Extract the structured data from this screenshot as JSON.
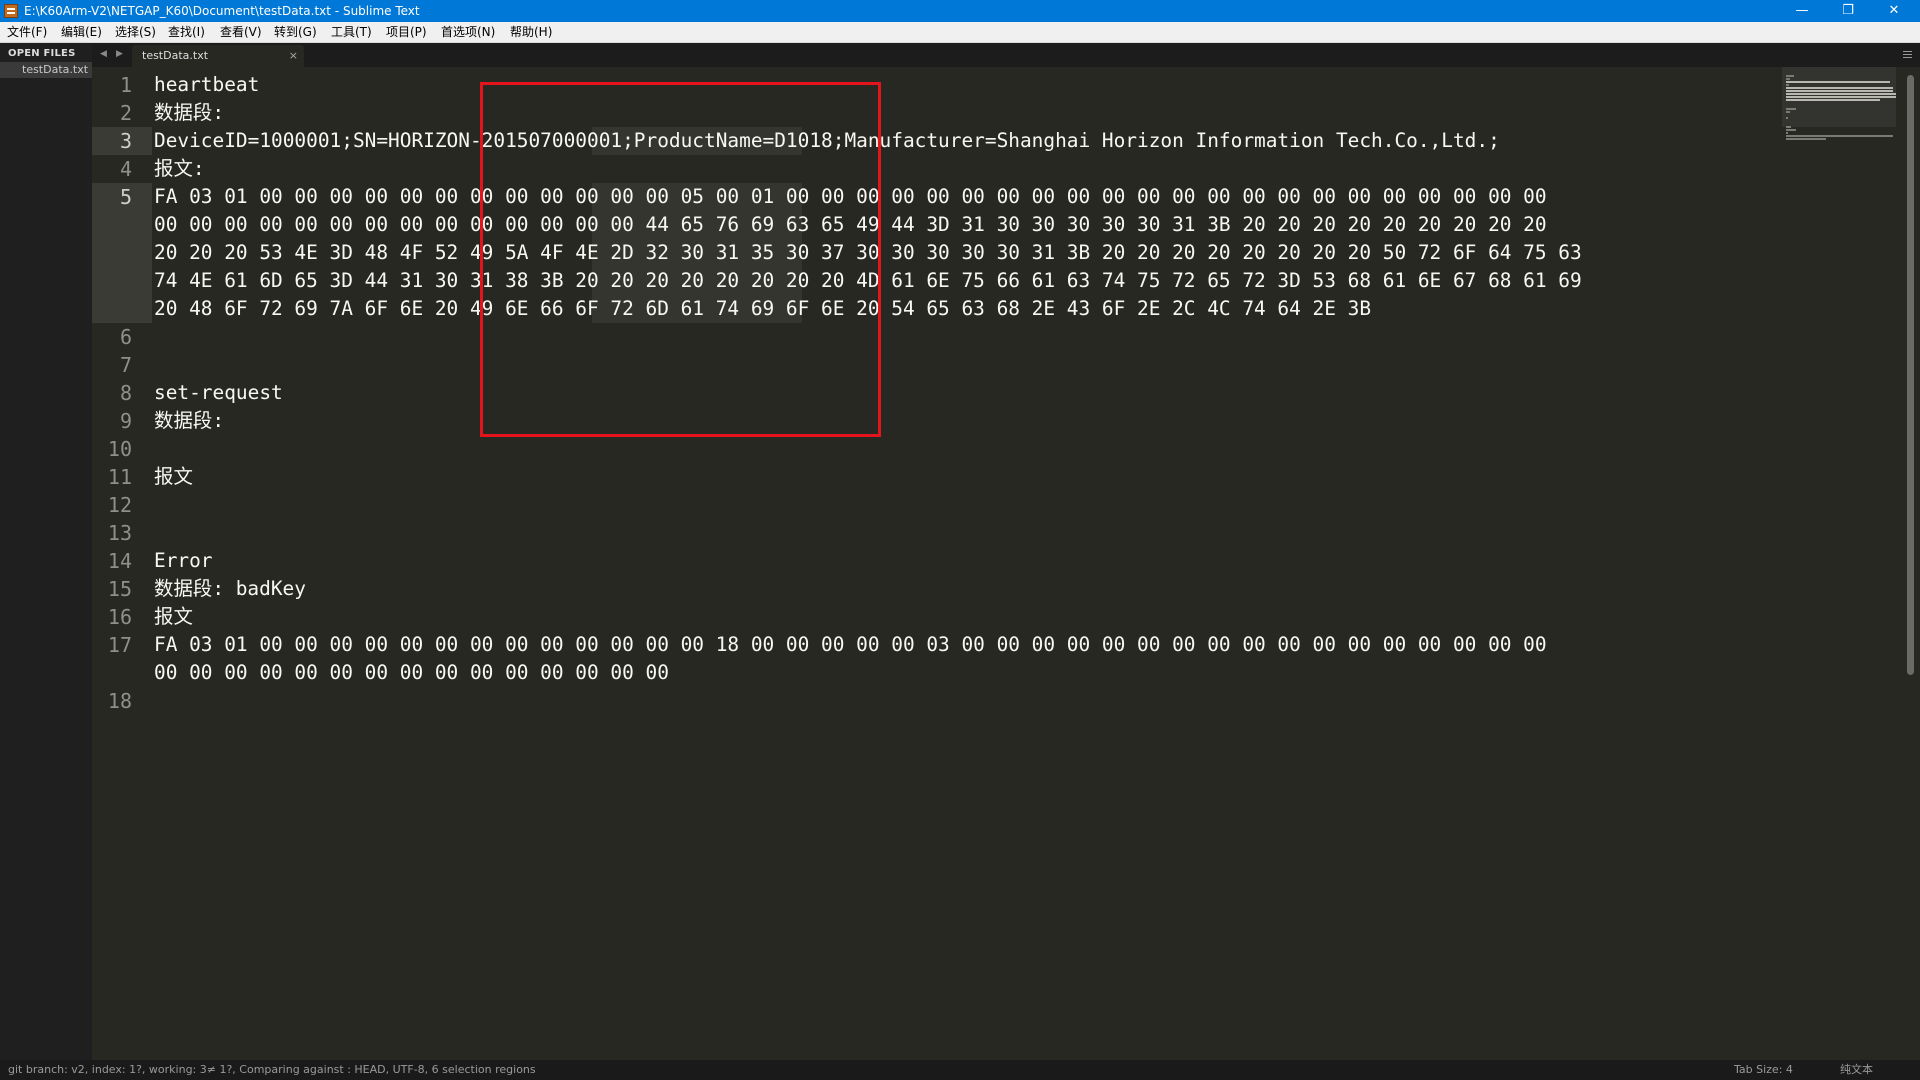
{
  "window": {
    "title": "E:\\K60Arm-V2\\NETGAP_K60\\Document\\testData.txt - Sublime Text",
    "minimize_glyph": "—",
    "restore_glyph": "❐",
    "close_glyph": "✕"
  },
  "menu": [
    "文件(F)",
    "编辑(E)",
    "选择(S)",
    "查找(I)",
    "查看(V)",
    "转到(G)",
    "工具(T)",
    "项目(P)",
    "首选项(N)",
    "帮助(H)"
  ],
  "sidebar": {
    "header": "OPEN FILES",
    "files": [
      "testData.txt"
    ]
  },
  "tabs": [
    {
      "label": "testData.txt",
      "close": "×"
    }
  ],
  "nav": {
    "back": "◀",
    "forward": "▶"
  },
  "editor": {
    "active_lines": [
      "3",
      "5"
    ],
    "lines": [
      {
        "num": "1",
        "rows": [
          "heartbeat"
        ]
      },
      {
        "num": "2",
        "rows": [
          "数据段:"
        ]
      },
      {
        "num": "3",
        "rows": [
          "DeviceID=1000001;SN=HORIZON-201507000001;ProductName=D1018;Manufacturer=Shanghai Horizon Information Tech.Co.,Ltd.;"
        ]
      },
      {
        "num": "4",
        "rows": [
          "报文:"
        ]
      },
      {
        "num": "5",
        "rows": [
          "FA 03 01 00 00 00 00 00 00 00 00 00 00 00 00 05 00 01 00 00 00 00 00 00 00 00 00 00 00 00 00 00 00 00 00 00 00 00 00 00",
          "00 00 00 00 00 00 00 00 00 00 00 00 00 00 44 65 76 69 63 65 49 44 3D 31 30 30 30 30 30 31 3B 20 20 20 20 20 20 20 20 20",
          "20 20 20 53 4E 3D 48 4F 52 49 5A 4F 4E 2D 32 30 31 35 30 37 30 30 30 30 30 31 3B 20 20 20 20 20 20 20 20 50 72 6F 64 75 63",
          "74 4E 61 6D 65 3D 44 31 30 31 38 3B 20 20 20 20 20 20 20 20 4D 61 6E 75 66 61 63 74 75 72 65 72 3D 53 68 61 6E 67 68 61 69",
          "20 48 6F 72 69 7A 6F 6E 20 49 6E 66 6F 72 6D 61 74 69 6F 6E 20 54 65 63 68 2E 43 6F 2E 2C 4C 74 64 2E 3B"
        ]
      },
      {
        "num": "6",
        "rows": [
          ""
        ]
      },
      {
        "num": "7",
        "rows": [
          ""
        ]
      },
      {
        "num": "8",
        "rows": [
          "set-request"
        ]
      },
      {
        "num": "9",
        "rows": [
          "数据段:"
        ]
      },
      {
        "num": "10",
        "rows": [
          ""
        ]
      },
      {
        "num": "11",
        "rows": [
          "报文"
        ]
      },
      {
        "num": "12",
        "rows": [
          ""
        ]
      },
      {
        "num": "13",
        "rows": [
          ""
        ]
      },
      {
        "num": "14",
        "rows": [
          "Error"
        ]
      },
      {
        "num": "15",
        "rows": [
          "数据段: badKey"
        ]
      },
      {
        "num": "16",
        "rows": [
          "报文"
        ]
      },
      {
        "num": "17",
        "rows": [
          "FA 03 01 00 00 00 00 00 00 00 00 00 00 00 00 00 18 00 00 00 00 00 03 00 00 00 00 00 00 00 00 00 00 00 00 00 00 00 00 00",
          "00 00 00 00 00 00 00 00 00 00 00 00 00 00 00"
        ]
      },
      {
        "num": "18",
        "rows": [
          ""
        ]
      }
    ]
  },
  "status": {
    "left": "git branch: v2, index: 1?, working: 3≠ 1?, Comparing against : HEAD, UTF-8, 6 selection regions",
    "tab_size": "Tab Size: 4",
    "syntax": "纯文本"
  },
  "colors": {
    "titlebar": "#0078d7",
    "editor_bg": "#272822",
    "text": "#f8f8f2",
    "annotation_box": "#e3141b"
  }
}
